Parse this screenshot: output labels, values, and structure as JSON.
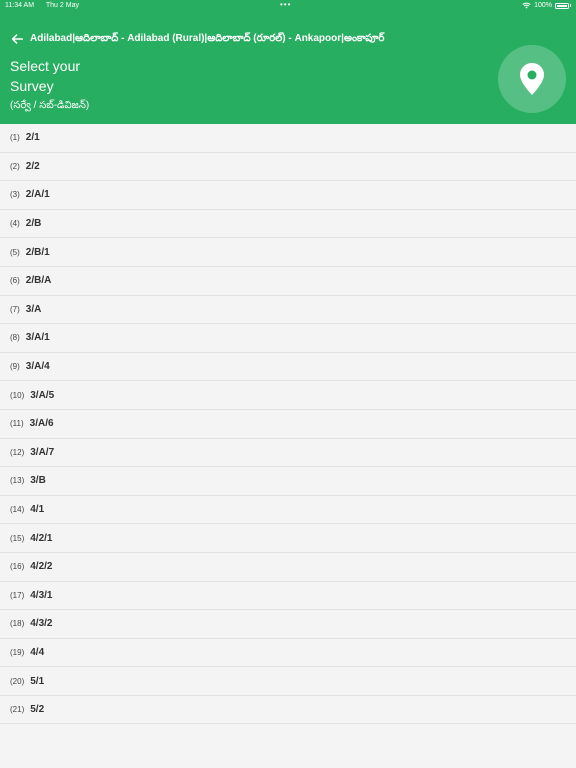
{
  "status_bar": {
    "time": "11:34 AM",
    "date": "Thu 2 May",
    "dots": "•••",
    "battery": "100%"
  },
  "header": {
    "breadcrumb": "Adilabad|ఆదిలాబాద్ - Adilabad (Rural)|ఆదిలాబాద్ (రూరల్) - Ankapoor|అంకాపూర్",
    "title": "Select your Survey",
    "subtitle": "(సర్వే / సబ్-డివిజన్)",
    "accent_color": "#27ae60"
  },
  "surveys": [
    {
      "num": "(1)",
      "value": "2/1"
    },
    {
      "num": "(2)",
      "value": "2/2"
    },
    {
      "num": "(3)",
      "value": "2/A/1"
    },
    {
      "num": "(4)",
      "value": "2/B"
    },
    {
      "num": "(5)",
      "value": "2/B/1"
    },
    {
      "num": "(6)",
      "value": "2/B/A"
    },
    {
      "num": "(7)",
      "value": "3/A"
    },
    {
      "num": "(8)",
      "value": "3/A/1"
    },
    {
      "num": "(9)",
      "value": "3/A/4"
    },
    {
      "num": "(10)",
      "value": "3/A/5"
    },
    {
      "num": "(11)",
      "value": "3/A/6"
    },
    {
      "num": "(12)",
      "value": "3/A/7"
    },
    {
      "num": "(13)",
      "value": "3/B"
    },
    {
      "num": "(14)",
      "value": "4/1"
    },
    {
      "num": "(15)",
      "value": "4/2/1"
    },
    {
      "num": "(16)",
      "value": "4/2/2"
    },
    {
      "num": "(17)",
      "value": "4/3/1"
    },
    {
      "num": "(18)",
      "value": "4/3/2"
    },
    {
      "num": "(19)",
      "value": "4/4"
    },
    {
      "num": "(20)",
      "value": "5/1"
    },
    {
      "num": "(21)",
      "value": "5/2"
    }
  ]
}
